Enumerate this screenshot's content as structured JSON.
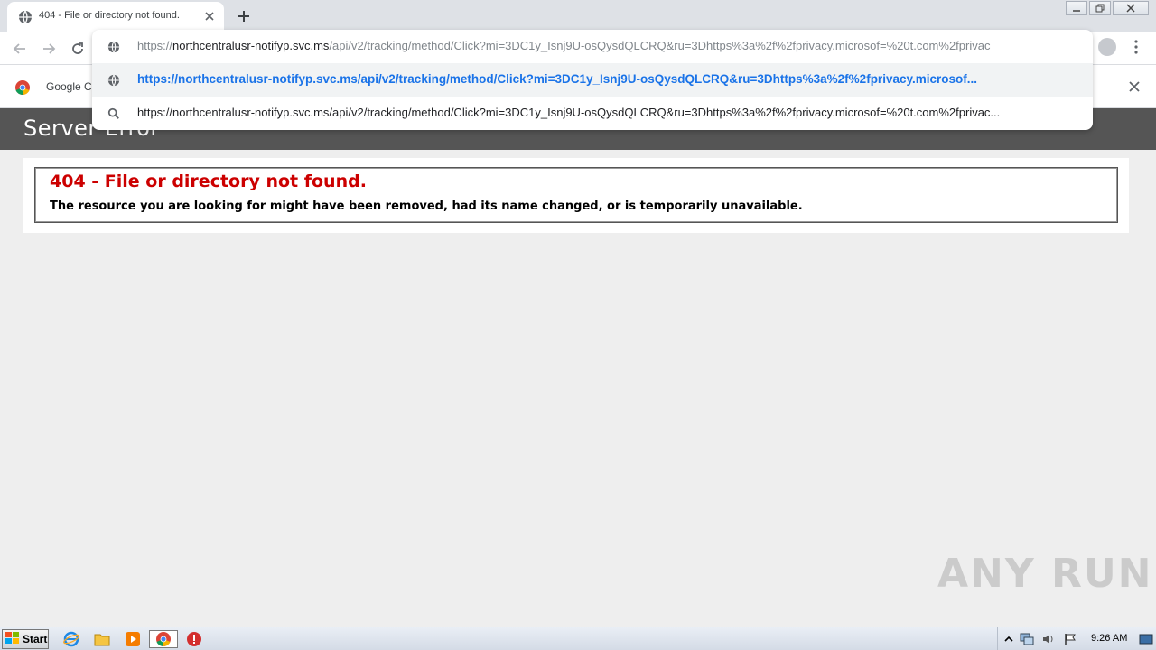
{
  "browser": {
    "tab": {
      "title": "404 - File or directory not found."
    },
    "omnibox": {
      "input_prefix": "https://",
      "input_host": "northcentralusr-notifyp.svc.ms",
      "input_rest": "/api/v2/tracking/method/Click?mi=3DC1y_Isnj9U-osQysdQLCRQ&ru=3Dhttps%3a%2f%2fprivacy.microsof=%20t.com%2fprivac",
      "suggestions": [
        {
          "icon": "globe-icon",
          "text": "https://northcentralusr-notifyp.svc.ms/api/v2/tracking/method/Click?mi=3DC1y_Isnj9U-osQysdQLCRQ&ru=3Dhttps%3a%2f%2fprivacy.microsof..."
        },
        {
          "icon": "search-icon",
          "text": "https://northcentralusr-notifyp.svc.ms/api/v2/tracking/method/Click?mi=3DC1y_Isnj9U-osQysdQLCRQ&ru=3Dhttps%3a%2f%2fprivacy.microsof=%20t.com%2fprivac..."
        }
      ]
    },
    "bookmarks": {
      "item_label": "Google Ch"
    }
  },
  "page": {
    "header": "Server Error",
    "error_title": "404 - File or directory not found.",
    "error_description": "The resource you are looking for might have been removed, had its name changed, or is temporarily unavailable."
  },
  "watermark": "ANY RUN",
  "taskbar": {
    "start_label": "Start",
    "clock": "9:26 AM"
  },
  "colors": {
    "error_red": "#cc0000",
    "header_gray": "#555555",
    "link_blue": "#1a73e8"
  }
}
